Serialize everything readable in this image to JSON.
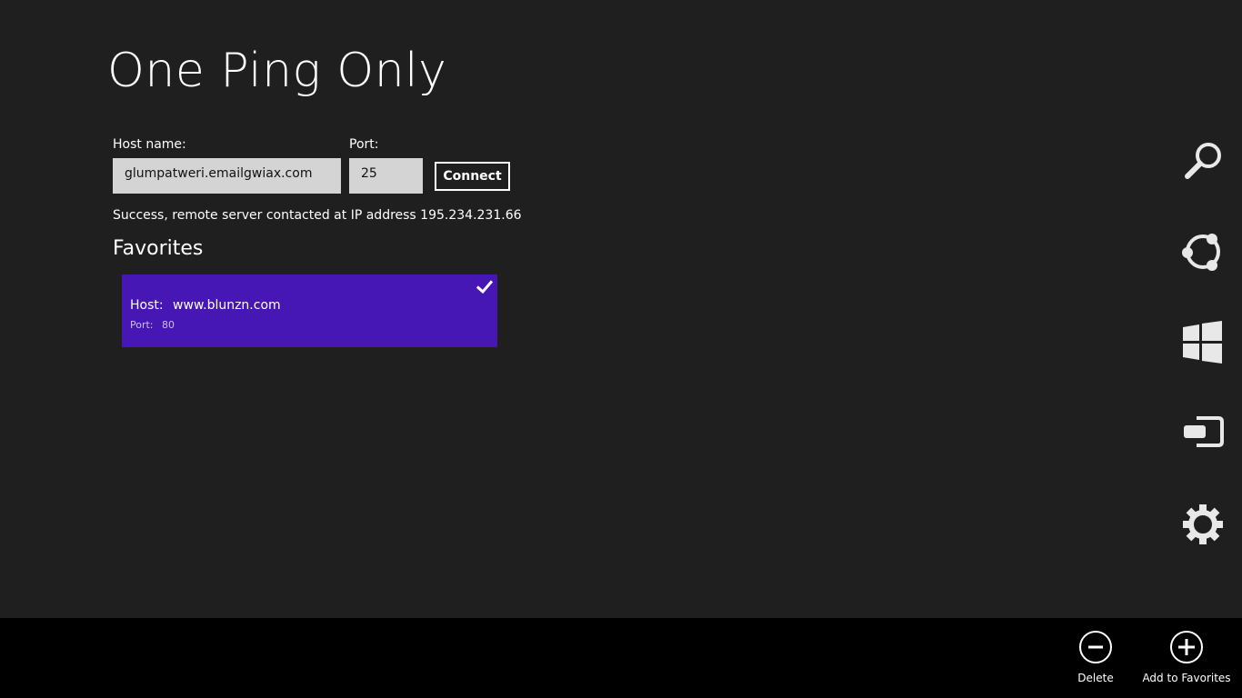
{
  "app": {
    "title": "One Ping Only"
  },
  "form": {
    "host_label": "Host name:",
    "host_value": "glumpatweri.emailgwiax.com",
    "port_label": "Port:",
    "port_value": "25",
    "connect_label": "Connect"
  },
  "status": {
    "message": "Success, remote server contacted at IP address 195.234.231.66"
  },
  "favorites": {
    "heading": "Favorites",
    "items": [
      {
        "host_key": "Host:",
        "host_value": "www.blunzn.com",
        "port_key": "Port:",
        "port_value": "80",
        "selected": true
      }
    ]
  },
  "charms": [
    {
      "icon": "search-icon"
    },
    {
      "icon": "share-icon"
    },
    {
      "icon": "windows-start-icon"
    },
    {
      "icon": "devices-icon"
    },
    {
      "icon": "settings-gear-icon"
    }
  ],
  "app_bar": {
    "delete_label": "Delete",
    "add_favorites_label": "Add to Favorites"
  },
  "colors": {
    "background": "#1f1f1f",
    "tile_accent": "#4617b4",
    "app_bar": "#000000",
    "input_fill": "#d4d4d4"
  }
}
